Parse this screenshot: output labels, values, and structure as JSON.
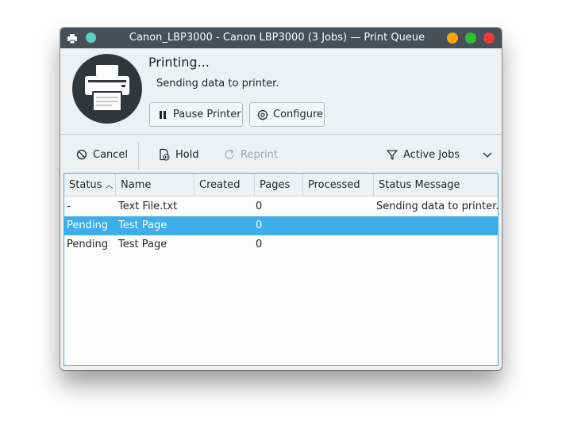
{
  "window": {
    "title": "Canon_LBP3000 - Canon LBP3000 (3 Jobs) — Print Queue"
  },
  "header": {
    "state_title": "Printing...",
    "state_message": "Sending data to printer.",
    "pause_label": "Pause Printer",
    "configure_label": "Configure"
  },
  "toolbar": {
    "cancel_label": "Cancel",
    "hold_label": "Hold",
    "reprint_label": "Reprint",
    "filter_label": "Active Jobs"
  },
  "table": {
    "columns": [
      "Status",
      "Name",
      "Created",
      "Pages",
      "Processed",
      "Status Message"
    ],
    "rows": [
      {
        "status": "-",
        "name": "Text File.txt",
        "created": "",
        "pages": "0",
        "processed": "",
        "message": "Sending data to printer."
      },
      {
        "status": "Pending",
        "name": "Test Page",
        "created": "",
        "pages": "0",
        "processed": "",
        "message": ""
      },
      {
        "status": "Pending",
        "name": "Test Page",
        "created": "",
        "pages": "0",
        "processed": "",
        "message": ""
      }
    ],
    "selected_row": 1
  },
  "colors": {
    "titlebar": "#475057",
    "selection": "#3daee9",
    "window_bg": "#eff0f1"
  }
}
